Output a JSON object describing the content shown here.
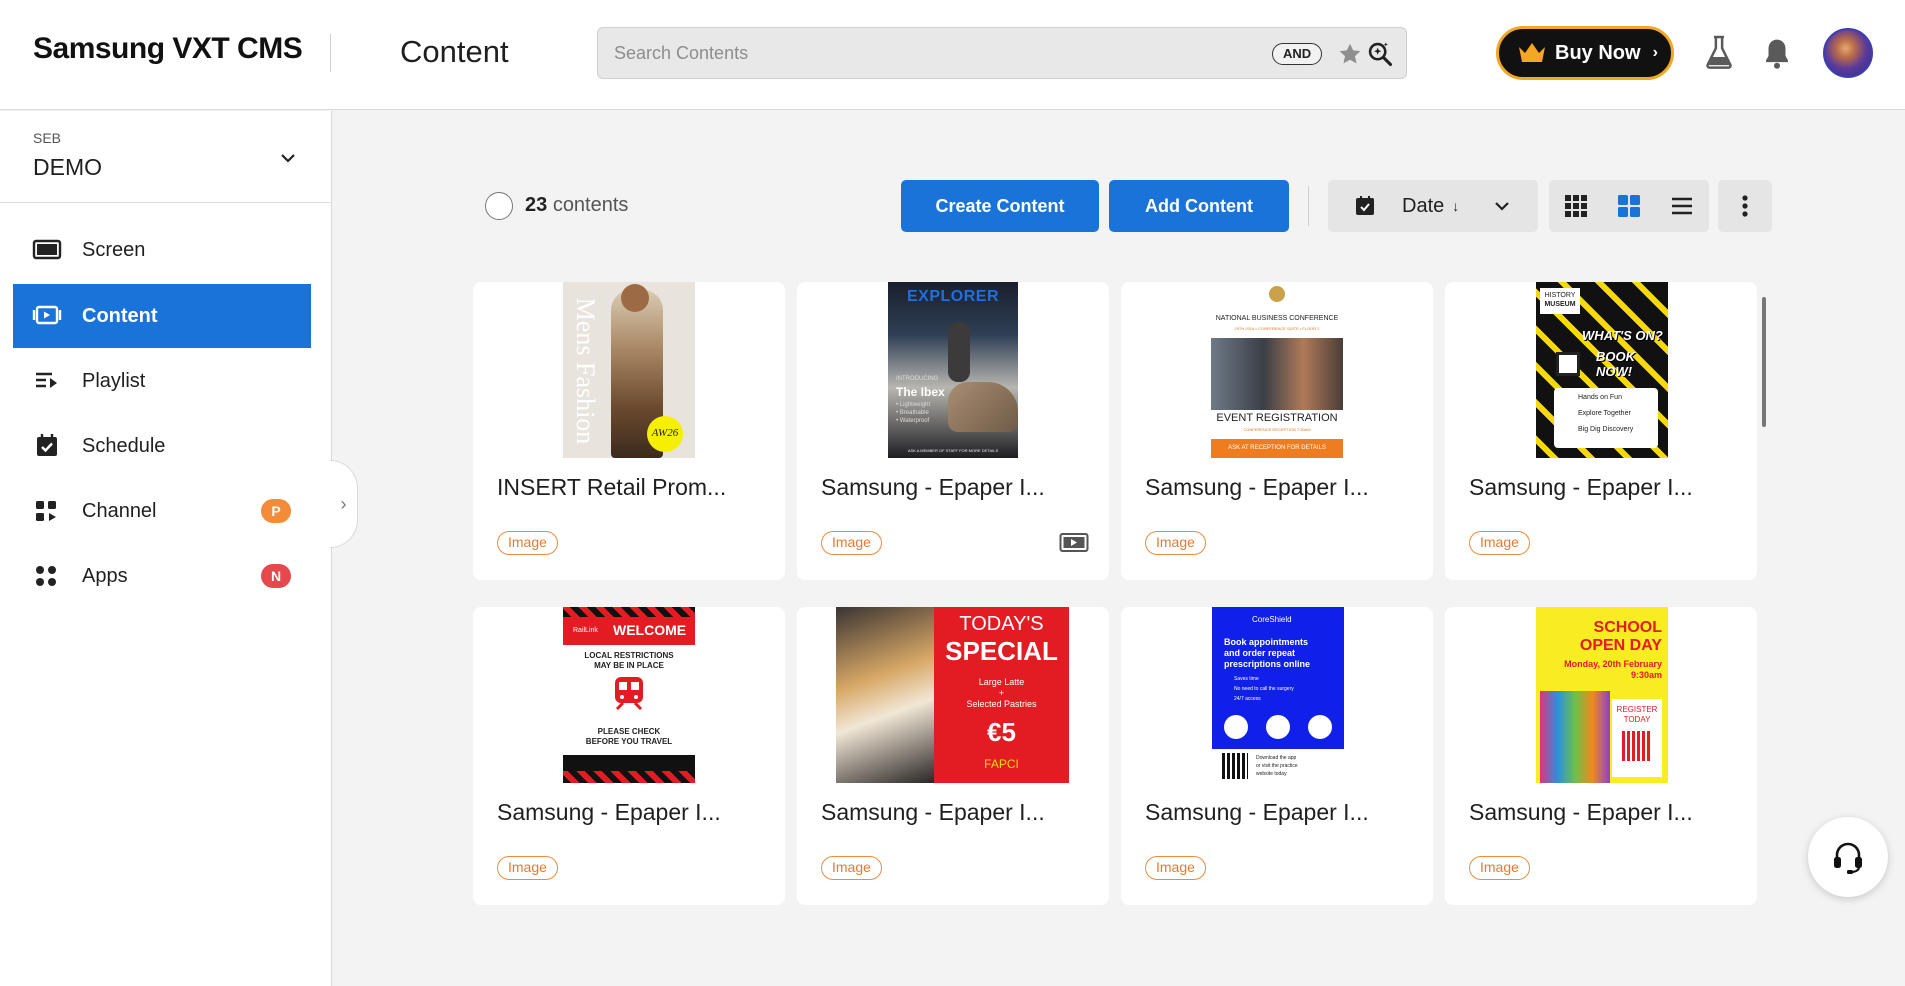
{
  "header": {
    "logo": "Samsung VXT CMS",
    "page_title": "Content",
    "search_placeholder": "Search Contents",
    "search_operator": "AND",
    "buy_label": "Buy Now"
  },
  "sidebar": {
    "org_label": "SEB",
    "org_name": "DEMO",
    "items": [
      {
        "label": "Screen",
        "icon": "screen-icon"
      },
      {
        "label": "Content",
        "icon": "content-icon",
        "active": true
      },
      {
        "label": "Playlist",
        "icon": "playlist-icon"
      },
      {
        "label": "Schedule",
        "icon": "schedule-icon"
      },
      {
        "label": "Channel",
        "icon": "channel-icon",
        "badge": "P",
        "badge_color": "#f28c38"
      },
      {
        "label": "Apps",
        "icon": "apps-icon",
        "badge": "N",
        "badge_color": "#e5484d"
      }
    ]
  },
  "toolbar": {
    "count": "23",
    "count_suffix": "contents",
    "create_label": "Create Content",
    "add_label": "Add Content",
    "sort_label": "Date",
    "sort_arrow": "↓"
  },
  "cards": [
    {
      "title": "INSERT Retail Prom...",
      "tag": "Image",
      "thumb_text": [
        "Mens Fashion",
        "AW26"
      ]
    },
    {
      "title": "Samsung - Epaper I...",
      "tag": "Image",
      "thumb_text": [
        "EXPLORER",
        "INTRODUCING",
        "The Ibex",
        "• Lightweight",
        "• Breathable",
        "• Waterproof",
        "ASK A MEMBER OF STAFF FOR MORE DETAILS"
      ]
    },
    {
      "title": "Samsung - Epaper I...",
      "tag": "Image",
      "thumb_text": [
        "NATIONAL BUSINESS CONFERENCE",
        "29TH 2014 • CONFERENCE SUITE • FLOOR 2",
        "EVENT REGISTRATION",
        "CONFERENCE RECEPTION 7:30AM",
        "ASK AT RECEPTION FOR DETAILS"
      ]
    },
    {
      "title": "Samsung - Epaper I...",
      "tag": "Image",
      "thumb_text": [
        "HISTORY",
        "MUSEUM",
        "WHAT'S ON?",
        "BOOK",
        "NOW!",
        "Hands on Fun",
        "Explore Together",
        "Big Dig Discovery"
      ]
    },
    {
      "title": "Samsung - Epaper I...",
      "tag": "Image",
      "thumb_text": [
        "RailLink",
        "WELCOME",
        "LOCAL RESTRICTIONS",
        "MAY BE IN PLACE",
        "PLEASE CHECK",
        "BEFORE YOU TRAVEL"
      ]
    },
    {
      "title": "Samsung - Epaper I...",
      "tag": "Image",
      "thumb_text": [
        "TODAY'S",
        "SPECIAL",
        "Large Latte",
        "+",
        "Selected Pastries",
        "€5",
        "FAPCI"
      ]
    },
    {
      "title": "Samsung - Epaper I...",
      "tag": "Image",
      "thumb_text": [
        "CoreShield",
        "Book appointments",
        "and order repeat",
        "prescriptions online",
        "Saves time",
        "No need to call the surgery",
        "24/7 access",
        "Download the app",
        "or visit the practice",
        "website today"
      ]
    },
    {
      "title": "Samsung - Epaper I...",
      "tag": "Image",
      "thumb_text": [
        "SCHOOL",
        "OPEN DAY",
        "Monday, 20th February",
        "9:30am",
        "REGISTER",
        "TODAY"
      ]
    }
  ]
}
